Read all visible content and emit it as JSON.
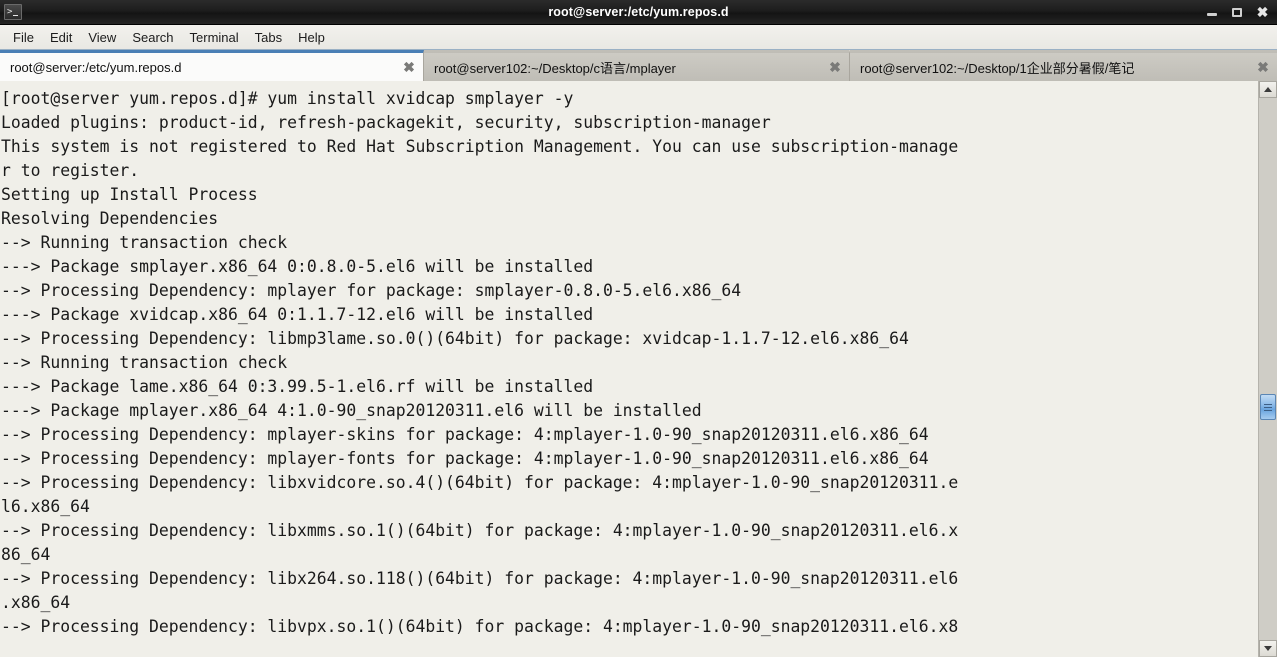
{
  "window": {
    "title": "root@server:/etc/yum.repos.d",
    "icon": "terminal-icon",
    "controls": {
      "minimize": "minimize",
      "maximize": "maximize",
      "close": "✖"
    }
  },
  "menubar": {
    "items": [
      {
        "label": "File"
      },
      {
        "label": "Edit"
      },
      {
        "label": "View"
      },
      {
        "label": "Search"
      },
      {
        "label": "Terminal"
      },
      {
        "label": "Tabs"
      },
      {
        "label": "Help"
      }
    ]
  },
  "tabs": [
    {
      "label": "root@server:/etc/yum.repos.d",
      "active": true,
      "close": "✖"
    },
    {
      "label": "root@server102:~/Desktop/c语言/mplayer",
      "active": false,
      "close": "✖"
    },
    {
      "label": "root@server102:~/Desktop/1企业部分暑假/笔记",
      "active": false,
      "close": "✖"
    }
  ],
  "terminal": {
    "background_color": "#f0efe9",
    "foreground_color": "#1a1a1a",
    "lines": [
      "[root@server yum.repos.d]# yum install xvidcap smplayer -y",
      "Loaded plugins: product-id, refresh-packagekit, security, subscription-manager",
      "This system is not registered to Red Hat Subscription Management. You can use subscription-manage",
      "r to register.",
      "Setting up Install Process",
      "Resolving Dependencies",
      "--> Running transaction check",
      "---> Package smplayer.x86_64 0:0.8.0-5.el6 will be installed",
      "--> Processing Dependency: mplayer for package: smplayer-0.8.0-5.el6.x86_64",
      "---> Package xvidcap.x86_64 0:1.1.7-12.el6 will be installed",
      "--> Processing Dependency: libmp3lame.so.0()(64bit) for package: xvidcap-1.1.7-12.el6.x86_64",
      "--> Running transaction check",
      "---> Package lame.x86_64 0:3.99.5-1.el6.rf will be installed",
      "---> Package mplayer.x86_64 4:1.0-90_snap20120311.el6 will be installed",
      "--> Processing Dependency: mplayer-skins for package: 4:mplayer-1.0-90_snap20120311.el6.x86_64",
      "--> Processing Dependency: mplayer-fonts for package: 4:mplayer-1.0-90_snap20120311.el6.x86_64",
      "--> Processing Dependency: libxvidcore.so.4()(64bit) for package: 4:mplayer-1.0-90_snap20120311.e",
      "l6.x86_64",
      "--> Processing Dependency: libxmms.so.1()(64bit) for package: 4:mplayer-1.0-90_snap20120311.el6.x",
      "86_64",
      "--> Processing Dependency: libx264.so.118()(64bit) for package: 4:mplayer-1.0-90_snap20120311.el6",
      ".x86_64",
      "--> Processing Dependency: libvpx.so.1()(64bit) for package: 4:mplayer-1.0-90_snap20120311.el6.x8"
    ]
  },
  "scrollbar": {
    "up_arrow": "scroll-up",
    "down_arrow": "scroll-down",
    "thumb": "scroll-thumb"
  }
}
